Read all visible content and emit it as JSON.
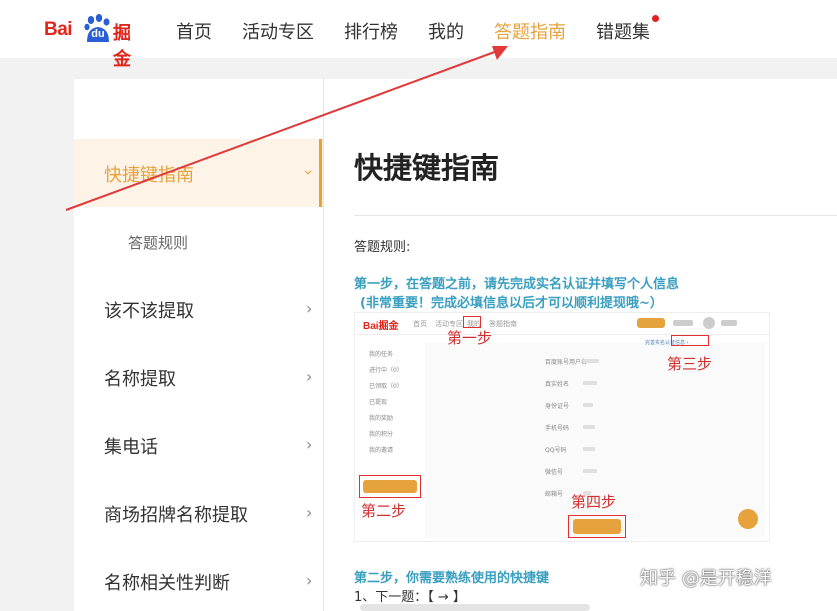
{
  "topbar": {
    "logo_bai": "Bai",
    "logo_du": "du",
    "logo_jue": "掘金",
    "nav": [
      {
        "label": "首页",
        "active": false
      },
      {
        "label": "活动专区",
        "active": false
      },
      {
        "label": "排行榜",
        "active": false
      },
      {
        "label": "我的",
        "active": false
      },
      {
        "label": "答题指南",
        "active": true
      },
      {
        "label": "错题集",
        "active": false
      }
    ]
  },
  "sidebar": {
    "active_item": "快捷键指南",
    "sub_item": "答题规则",
    "items": [
      "该不该提取",
      "名称提取",
      "集电话",
      "商场招牌名称提取",
      "名称相关性判断"
    ]
  },
  "main": {
    "title": "快捷键指南",
    "rules_label": "答题规则:",
    "step1_line1": "第一步，在答题之前，请先完成实名认证并填写个人信息",
    "step1_line2": "(非常重要！完成必填信息以后才可以顺利提现哦~）",
    "step2": "第二步，你需要熟练使用的快捷键",
    "shortcut1": "1、下一题：【 → 】"
  },
  "screenshot": {
    "mini_logo": "Bai掘金",
    "mini_nav": [
      "首页",
      "活动专区",
      "我的",
      "答题指南"
    ],
    "side_items": [
      "我的任务",
      "进行中（0）",
      "已领取（0）",
      "已提现",
      "我的奖励",
      "我的积分",
      "我的邀请"
    ],
    "form_labels": [
      "百度账号用户名",
      "真实姓名",
      "身份证号",
      "手机号码",
      "QQ号码",
      "微信号",
      "邮箱号"
    ],
    "steps": [
      "第一步",
      "第二步",
      "第三步",
      "第四步"
    ]
  },
  "watermark": "知乎 @是开稳洋",
  "colors": {
    "accent": "#e6a23c",
    "brand_red": "#e1261c",
    "step_blue": "#3a9fc0",
    "annotation_red": "#d23030"
  }
}
